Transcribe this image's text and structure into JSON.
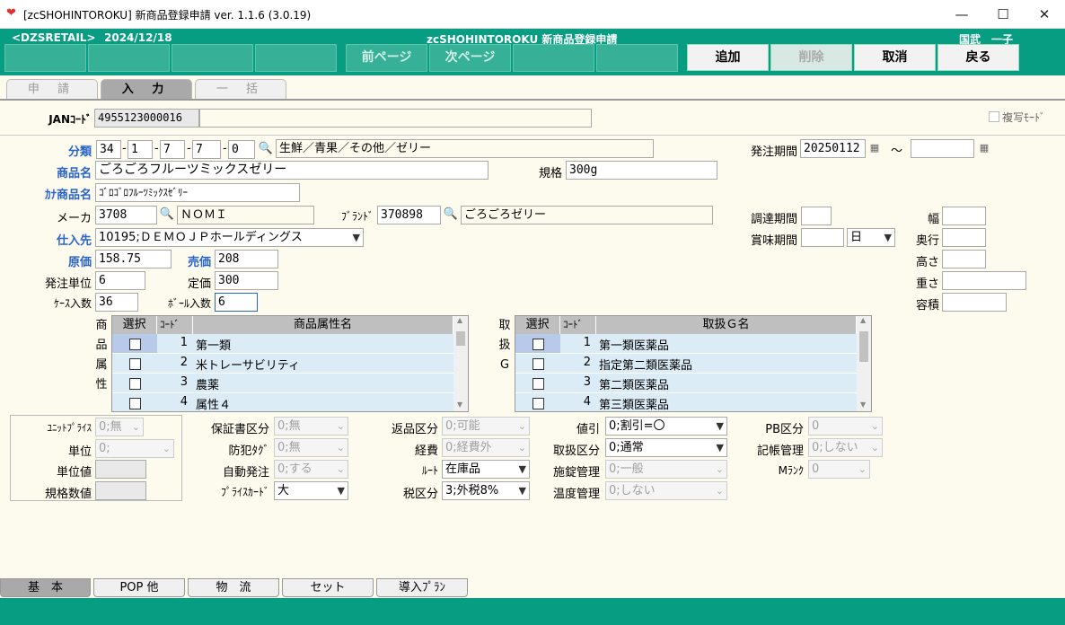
{
  "window": {
    "title": "[zcSHOHINTOROKU] 新商品登録申請 ver. 1.1.6 (3.0.19)",
    "minimize": "—",
    "maximize": "☐",
    "close": "✕"
  },
  "header": {
    "store": "<DZSRETAIL>",
    "date": "2024/12/18",
    "app_title": "zcSHOHINTOROKU  新商品登録申請",
    "user": "国武　一子"
  },
  "toolbar": {
    "prev_page": "前ページ",
    "next_page": "次ページ",
    "add": "追加",
    "delete": "削除",
    "cancel": "取消",
    "back": "戻る"
  },
  "tabs": {
    "apply": "申 請",
    "input": "入 力",
    "bulk": "一 括"
  },
  "jan": {
    "label": "JANｺｰﾄﾞ",
    "value": "4955123000016"
  },
  "copy_mode": {
    "label": "複写ﾓｰﾄﾞ"
  },
  "category": {
    "label": "分類",
    "c1": "34",
    "c2": "1",
    "c3": "7",
    "c4": "7",
    "c5": "0",
    "name": "生鮮／青果／その他／ゼリー"
  },
  "order_period": {
    "label": "発注期間",
    "from": "20250112",
    "tilde": "〜",
    "to": ""
  },
  "product_name": {
    "label": "商品名",
    "value": "ごろごろフルーツミックスゼリー"
  },
  "spec": {
    "label": "規格",
    "value": "300g"
  },
  "kana_name": {
    "label": "ｶﾅ商品名",
    "value": "ｺﾞﾛｺﾞﾛﾌﾙｰﾂﾐｯｸｽｾﾞﾘｰ"
  },
  "maker": {
    "label": "メーカ",
    "code": "3708",
    "name": "ＮＯＭＩ"
  },
  "brand": {
    "label": "ﾌﾞﾗﾝﾄﾞ",
    "code": "370898",
    "name": "ごろごろゼリー"
  },
  "procure_period": {
    "label": "調達期間",
    "value": ""
  },
  "width": {
    "label": "幅",
    "value": ""
  },
  "supplier": {
    "label": "仕入先",
    "value": "10195;ＤＥＭＯＪＰホールディングス"
  },
  "shelf_life": {
    "label": "賞味期間",
    "value": "",
    "unit": "日"
  },
  "depth": {
    "label": "奥行",
    "value": ""
  },
  "cost": {
    "label": "原価",
    "value": "158.75"
  },
  "price": {
    "label": "売価",
    "value": "208"
  },
  "height": {
    "label": "高さ",
    "value": ""
  },
  "order_unit": {
    "label": "発注単位",
    "value": "6"
  },
  "list_price": {
    "label": "定価",
    "value": "300"
  },
  "weight": {
    "label": "重さ",
    "value": ""
  },
  "case_qty": {
    "label": "ｹｰｽ入数",
    "value": "36"
  },
  "ball_qty": {
    "label": "ﾎﾞｰﾙ入数",
    "value": "6"
  },
  "volume": {
    "label": "容積",
    "value": ""
  },
  "attr_grid": {
    "side_label": [
      "商",
      "品",
      "属",
      "性"
    ],
    "headers": {
      "select": "選択",
      "code": "ｺｰﾄﾞ",
      "name": "商品属性名"
    },
    "rows": [
      {
        "code": "1",
        "name": "第一類"
      },
      {
        "code": "2",
        "name": "米トレーサビリティ"
      },
      {
        "code": "3",
        "name": "農薬"
      },
      {
        "code": "4",
        "name": "属性４"
      }
    ]
  },
  "handling_grid": {
    "side_label": [
      "取",
      "扱",
      "G"
    ],
    "headers": {
      "select": "選択",
      "code": "ｺｰﾄﾞ",
      "name": "取扱Ｇ名"
    },
    "rows": [
      {
        "code": "1",
        "name": "第一類医薬品"
      },
      {
        "code": "2",
        "name": "指定第二類医薬品"
      },
      {
        "code": "3",
        "name": "第二類医薬品"
      },
      {
        "code": "4",
        "name": "第三類医薬品"
      }
    ]
  },
  "unit_box": {
    "unit_price": {
      "label": "ﾕﾆｯﾄﾌﾟﾗｲｽ",
      "value": "0;無"
    },
    "unit": {
      "label": "単位",
      "value": "0;"
    },
    "unit_value": {
      "label": "単位値",
      "value": ""
    },
    "spec_value": {
      "label": "規格数値",
      "value": ""
    }
  },
  "options": {
    "warranty": {
      "label": "保証書区分",
      "value": "0;無"
    },
    "security_tag": {
      "label": "防犯ﾀｸﾞ",
      "value": "0;無"
    },
    "auto_order": {
      "label": "自動発注",
      "value": "0;する"
    },
    "price_card": {
      "label": "ﾌﾟﾗｲｽｶｰﾄﾞ",
      "value": "大"
    },
    "return_type": {
      "label": "返品区分",
      "value": "0;可能"
    },
    "expense": {
      "label": "経費",
      "value": "0;経費外"
    },
    "route": {
      "label": "ﾙｰﾄ",
      "value": "在庫品"
    },
    "tax": {
      "label": "税区分",
      "value": "3;外税8%"
    },
    "discount": {
      "label": "値引",
      "value": "0;割引=〇"
    },
    "handling_type": {
      "label": "取扱区分",
      "value": "0;通常"
    },
    "lock_mgmt": {
      "label": "施錠管理",
      "value": "0;一般"
    },
    "temp_mgmt": {
      "label": "温度管理",
      "value": "0;しない"
    },
    "pb_type": {
      "label": "PB区分",
      "value": "0"
    },
    "ledger_mgmt": {
      "label": "記帳管理",
      "value": "0;しない"
    },
    "m_rank": {
      "label": "Mﾗﾝｸ",
      "value": "0"
    }
  },
  "bottom_tabs": {
    "basic": "基　本",
    "pop": "POP 他",
    "logistics": "物　流",
    "set": "セット",
    "plan": "導入ﾌﾟﾗﾝ"
  }
}
